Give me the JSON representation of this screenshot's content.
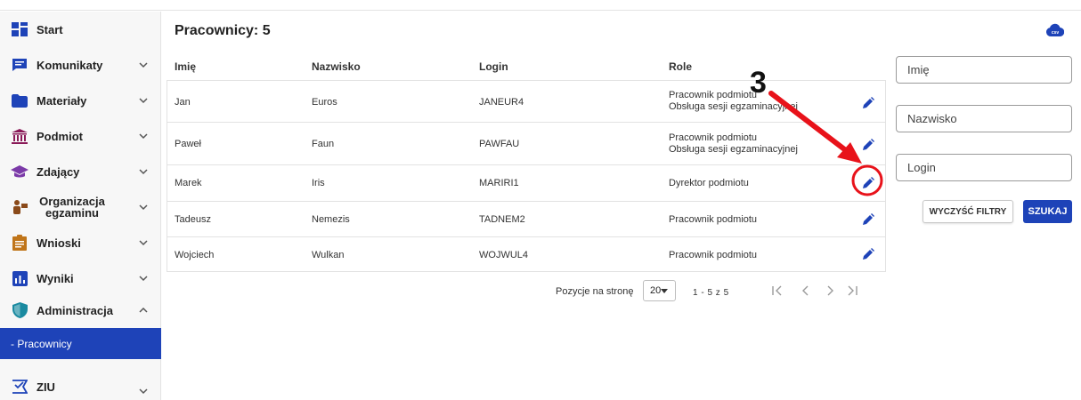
{
  "sidebar": {
    "items": [
      {
        "label": "Start",
        "icon": "dashboard-icon"
      },
      {
        "label": "Komunikaty",
        "icon": "message-icon"
      },
      {
        "label": "Materiały",
        "icon": "folder-icon"
      },
      {
        "label": "Podmiot",
        "icon": "institution-icon"
      },
      {
        "label": "Zdający",
        "icon": "graduation-cap-icon"
      },
      {
        "label": "Organizacja egzaminu",
        "icon": "presenter-icon"
      },
      {
        "label": "Wnioski",
        "icon": "clipboard-icon"
      },
      {
        "label": "Wyniki",
        "icon": "bar-chart-icon"
      },
      {
        "label": "Administracja",
        "icon": "shield-icon"
      },
      {
        "label": "ZIU",
        "icon": "ziu-icon"
      }
    ],
    "sub_item": "- Pracownicy"
  },
  "main": {
    "title": "Pracownicy: 5",
    "columns": {
      "first_name": "Imię",
      "last_name": "Nazwisko",
      "login": "Login",
      "roles": "Role"
    },
    "rows": [
      {
        "first_name": "Jan",
        "last_name": "Euros",
        "login": "JANEUR4",
        "roles": [
          "Pracownik podmiotu",
          "Obsługa sesji egzaminacyjnej"
        ]
      },
      {
        "first_name": "Paweł",
        "last_name": "Faun",
        "login": "PAWFAU",
        "roles": [
          "Pracownik podmiotu",
          "Obsługa sesji egzaminacyjnej"
        ]
      },
      {
        "first_name": "Marek",
        "last_name": "Iris",
        "login": "MARIRI1",
        "roles": [
          "Dyrektor podmiotu"
        ]
      },
      {
        "first_name": "Tadeusz",
        "last_name": "Nemezis",
        "login": "TADNEM2",
        "roles": [
          "Pracownik podmiotu"
        ]
      },
      {
        "first_name": "Wojciech",
        "last_name": "Wulkan",
        "login": "WOJWUL4",
        "roles": [
          "Pracownik podmiotu"
        ]
      }
    ],
    "pagination": {
      "per_page_label": "Pozycje na stronę",
      "per_page_value": "20",
      "range": "1 - 5 z 5"
    }
  },
  "filters": {
    "first_name_placeholder": "Imię",
    "last_name_placeholder": "Nazwisko",
    "login_placeholder": "Login",
    "clear_label": "WYCZYŚĆ FILTRY",
    "search_label": "SZUKAJ"
  },
  "annotation": {
    "step": "3",
    "color": "#e8121a"
  },
  "colors": {
    "accent": "#1e43b8",
    "icon_blue": "#1e43b8"
  }
}
